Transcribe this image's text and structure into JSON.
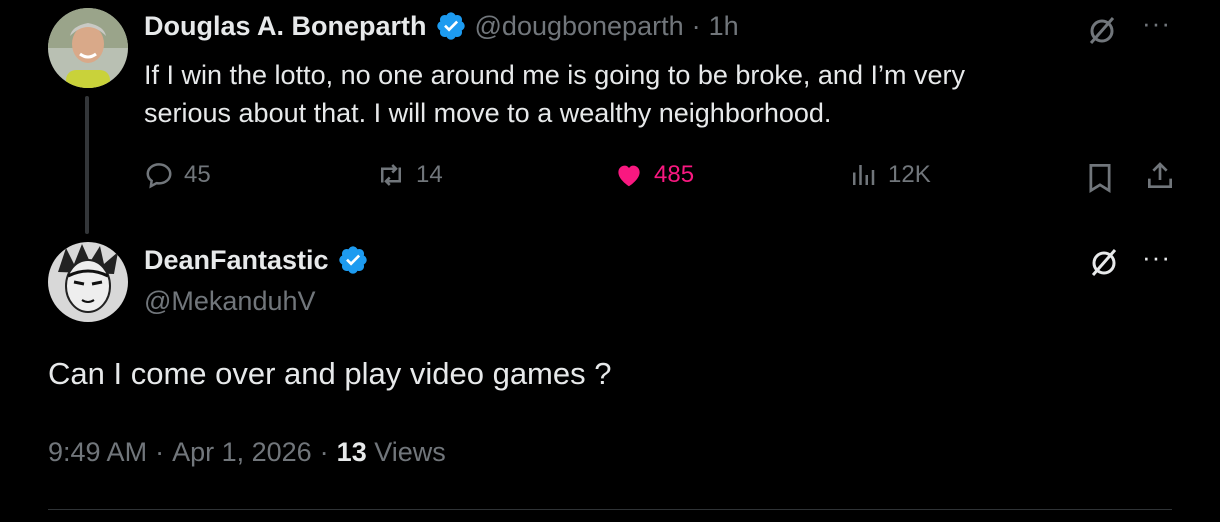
{
  "tweet": {
    "author_name": "Douglas A. Boneparth",
    "author_handle": "@dougboneparth",
    "separator": "·",
    "time_ago": "1h",
    "text_line1": "If I win the lotto, no one around me is going to be broke, and I’m very",
    "text_line2": "serious about that. I will move to a wealthy neighborhood.",
    "replies": "45",
    "reposts": "14",
    "likes": "485",
    "views": "12K",
    "more": "···"
  },
  "reply": {
    "author_name": "DeanFantastic",
    "author_handle": "@MekanduhV",
    "text": "Can I come over and play video games ?",
    "time": "9:49 AM",
    "date": "Apr 1, 2026",
    "views_count": "13",
    "views_label": "Views",
    "dot": "·",
    "more": "···"
  },
  "colors": {
    "background": "#000000",
    "text_primary": "#e7e9ea",
    "text_secondary": "#71767b",
    "verified_blue": "#1d9bf0",
    "like_pink": "#f91880"
  },
  "icons": [
    "grok-icon",
    "more-icon",
    "reply-icon",
    "repost-icon",
    "like-icon",
    "views-icon",
    "bookmark-icon",
    "share-icon",
    "verified-badge-icon"
  ]
}
